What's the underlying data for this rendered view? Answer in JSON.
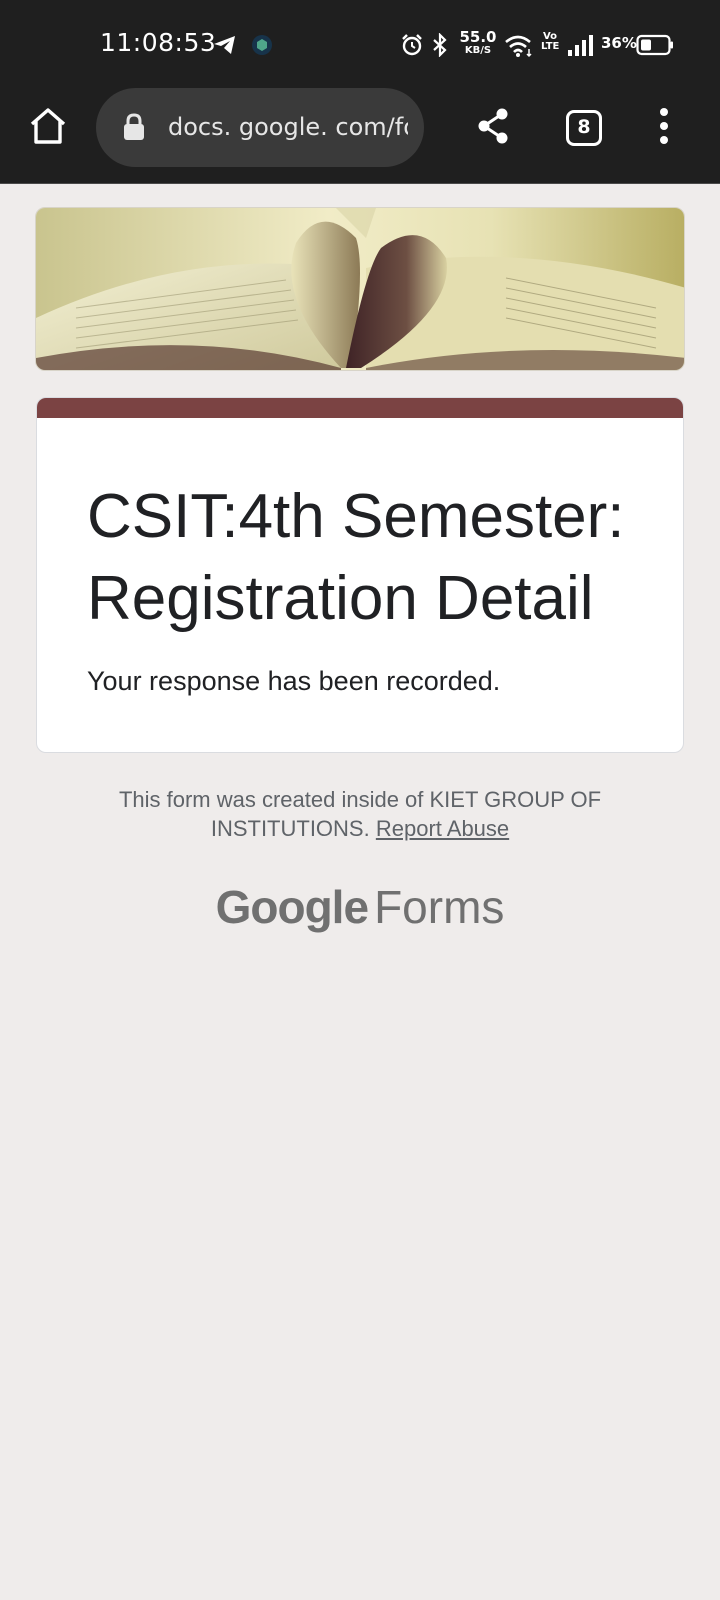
{
  "status_bar": {
    "time": "11:08:53",
    "net_speed_value": "55.0",
    "net_speed_unit": "KB/S",
    "volte": "Vo LTE",
    "battery_percent": "36%"
  },
  "browser": {
    "url": "docs. google. com/forms",
    "tab_count": "8"
  },
  "form": {
    "title": "CSIT:4th Semester: Registration Detail",
    "response_message": "Your response has been recorded.",
    "accent_color": "#7b4343"
  },
  "footer": {
    "created_text": "This form was created inside of KIET GROUP OF INSTITUTIONS.",
    "report_abuse": "Report Abuse",
    "logo_google": "Google",
    "logo_forms": "Forms"
  }
}
